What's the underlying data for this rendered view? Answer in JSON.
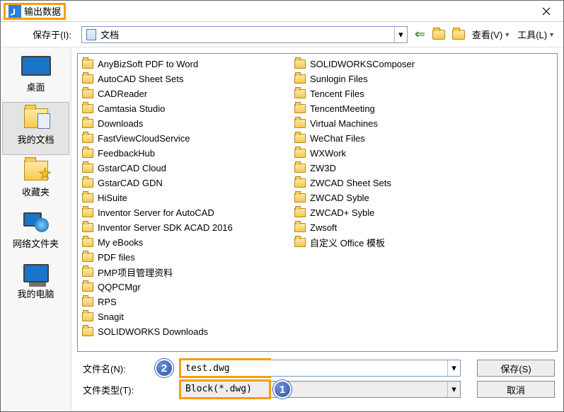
{
  "title": "输出数据",
  "save_in_label": "保存于(I):",
  "current_folder": "文档",
  "toolbar": {
    "view_label": "查看(V)",
    "tools_label": "工具(L)"
  },
  "places": [
    {
      "name": "desktop",
      "label": "桌面"
    },
    {
      "name": "my-documents",
      "label": "我的文档"
    },
    {
      "name": "favorites",
      "label": "收藏夹"
    },
    {
      "name": "network",
      "label": "网络文件夹"
    },
    {
      "name": "my-computer",
      "label": "我的电脑"
    }
  ],
  "folders_col1": [
    "AnyBizSoft PDF to Word",
    "AutoCAD Sheet Sets",
    "CADReader",
    "Camtasia Studio",
    "Downloads",
    "FastViewCloudService",
    "FeedbackHub",
    "GstarCAD Cloud",
    "GstarCAD GDN",
    "HiSuite",
    "Inventor Server for AutoCAD",
    "Inventor Server SDK ACAD 2016",
    "My eBooks",
    "PDF files",
    "PMP项目管理资料",
    "QQPCMgr",
    "RPS",
    "Snagit"
  ],
  "folders_col2": [
    "SOLIDWORKS Downloads",
    "SOLIDWORKSComposer",
    "Sunlogin Files",
    "Tencent Files",
    "TencentMeeting",
    "Virtual Machines",
    "WeChat Files",
    "WXWork",
    "ZW3D",
    "ZWCAD Sheet Sets",
    "ZWCAD Syble",
    "ZWCAD+ Syble",
    "Zwsoft",
    "自定义 Office 模板"
  ],
  "filename_label": "文件名(N):",
  "filetype_label": "文件类型(T):",
  "filename_value": "test.dwg",
  "filetype_value": "Block(*.dwg)",
  "save_btn": "保存(S)",
  "cancel_btn": "取消",
  "badge1": "1",
  "badge2": "2"
}
